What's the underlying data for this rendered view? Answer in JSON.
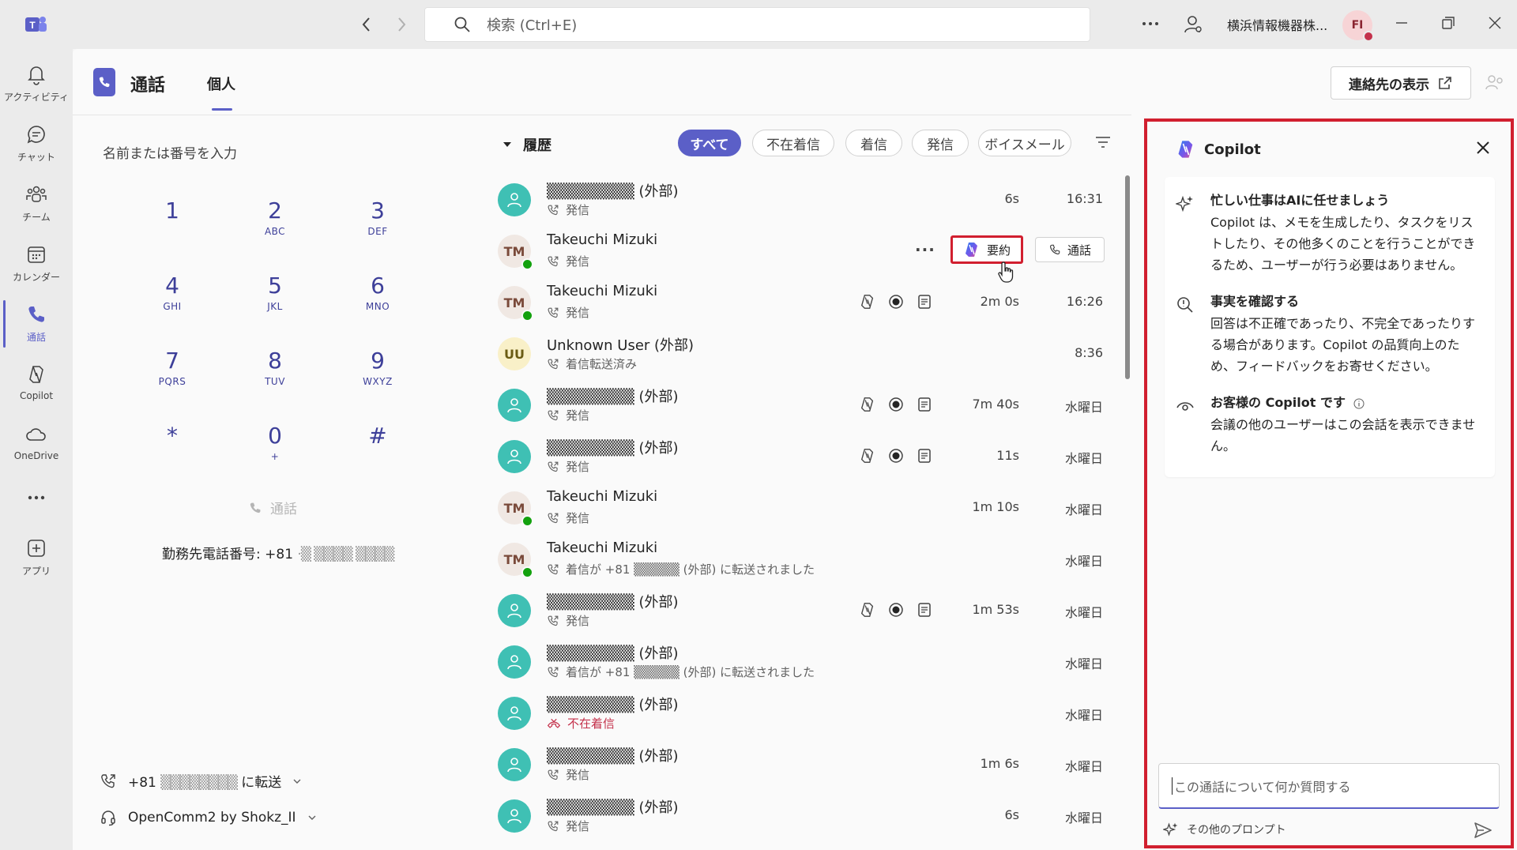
{
  "titlebar": {
    "search_placeholder": "検索 (Ctrl+E)",
    "org_name": "横浜情報機器株...",
    "avatar_initials": "FI"
  },
  "rail": {
    "items": [
      {
        "label": "アクティビティ",
        "icon": "bell-icon"
      },
      {
        "label": "チャット",
        "icon": "chat-icon"
      },
      {
        "label": "チーム",
        "icon": "teams-icon"
      },
      {
        "label": "カレンダー",
        "icon": "calendar-icon"
      },
      {
        "label": "通話",
        "icon": "phone-icon"
      },
      {
        "label": "Copilot",
        "icon": "copilot-icon"
      },
      {
        "label": "OneDrive",
        "icon": "cloud-icon"
      },
      {
        "label": "...",
        "icon": "more-icon"
      },
      {
        "label": "アプリ",
        "icon": "apps-icon"
      }
    ]
  },
  "header": {
    "title": "通話",
    "tab_personal": "個人",
    "contacts_button": "連絡先の表示"
  },
  "dialpad": {
    "input_placeholder": "名前または番号を入力",
    "keys": [
      {
        "n": "1",
        "s": ""
      },
      {
        "n": "2",
        "s": "ABC"
      },
      {
        "n": "3",
        "s": "DEF"
      },
      {
        "n": "4",
        "s": "GHI"
      },
      {
        "n": "5",
        "s": "JKL"
      },
      {
        "n": "6",
        "s": "MNO"
      },
      {
        "n": "7",
        "s": "PQRS"
      },
      {
        "n": "8",
        "s": "TUV"
      },
      {
        "n": "9",
        "s": "WXYZ"
      },
      {
        "n": "*",
        "s": ""
      },
      {
        "n": "0",
        "s": "+"
      },
      {
        "n": "#",
        "s": ""
      }
    ],
    "call_label": "通話",
    "work_phone_label": "勤務先電話番号: +81",
    "work_phone_number": "·▒ ▒▒▒▒ ▒▒▒▒",
    "forward_prefix": "+81",
    "forward_number": "▒▒▒▒▒▒▒▒",
    "forward_suffix": "に転送",
    "device": "OpenComm2 by Shokz_II"
  },
  "history": {
    "title": "履歴",
    "filters": [
      "すべて",
      "不在着信",
      "着信",
      "発信",
      "ボイスメール"
    ],
    "summary_button": "要約",
    "call_button": "通話",
    "rows": [
      {
        "name": "▒▒▒▒▒▒▒▒ (外部)",
        "sub": "発信",
        "dur": "6s",
        "time": "16:31",
        "av": "teal",
        "initials": ""
      },
      {
        "name": "Takeuchi Mizuki",
        "sub": "発信",
        "dur": "",
        "time": "",
        "av": "tm",
        "initials": "TM"
      },
      {
        "name": "Takeuchi Mizuki",
        "sub": "発信",
        "dur": "2m 0s",
        "time": "16:26",
        "av": "tm",
        "initials": "TM"
      },
      {
        "name": "Unknown User (外部)",
        "sub": "着信転送済み",
        "dur": "",
        "time": "8:36",
        "av": "uu",
        "initials": "UU"
      },
      {
        "name": "▒▒▒▒▒▒▒▒ (外部)",
        "sub": "発信",
        "dur": "7m 40s",
        "time": "水曜日",
        "av": "teal",
        "initials": ""
      },
      {
        "name": "▒▒▒▒▒▒▒▒ (外部)",
        "sub": "発信",
        "dur": "11s",
        "time": "水曜日",
        "av": "teal",
        "initials": ""
      },
      {
        "name": "Takeuchi Mizuki",
        "sub": "発信",
        "dur": "1m 10s",
        "time": "水曜日",
        "av": "tm",
        "initials": "TM"
      },
      {
        "name": "Takeuchi Mizuki",
        "sub": "着信が +81 ▒▒▒▒▒ (外部) に転送されました",
        "dur": "",
        "time": "水曜日",
        "av": "tm",
        "initials": "TM"
      },
      {
        "name": "▒▒▒▒▒▒▒▒ (外部)",
        "sub": "発信",
        "dur": "1m 53s",
        "time": "水曜日",
        "av": "teal",
        "initials": ""
      },
      {
        "name": "▒▒▒▒▒▒▒▒ (外部)",
        "sub": "着信が +81 ▒▒▒▒▒ (外部) に転送されました",
        "dur": "",
        "time": "水曜日",
        "av": "teal",
        "initials": ""
      },
      {
        "name": "▒▒▒▒▒▒▒▒ (外部)",
        "sub": "不在着信",
        "dur": "",
        "time": "水曜日",
        "av": "teal",
        "initials": ""
      },
      {
        "name": "▒▒▒▒▒▒▒▒ (外部)",
        "sub": "発信",
        "dur": "1m 6s",
        "time": "水曜日",
        "av": "teal",
        "initials": ""
      },
      {
        "name": "▒▒▒▒▒▒▒▒ (外部)",
        "sub": "発信",
        "dur": "6s",
        "time": "水曜日",
        "av": "teal",
        "initials": ""
      }
    ]
  },
  "copilot": {
    "title": "Copilot",
    "items": [
      {
        "title": "忙しい仕事はAIに任せましょう",
        "desc": "Copilot は、メモを生成したり、タスクをリストしたり、その他多くのことを行うことができるため、ユーザーが行う必要はありません。"
      },
      {
        "title": "事実を確認する",
        "desc": "回答は不正確であったり、不完全であったりする場合があります。Copilot の品質向上のため、フィードバックをお寄せください。"
      },
      {
        "title": "お客様の Copilot です",
        "desc": "会議の他のユーザーはこの会話を表示できません。"
      }
    ],
    "input_placeholder": "この通話について何か質問する",
    "more_prompts": "その他のプロンプト"
  },
  "colors": {
    "accent": "#5b5fc7",
    "highlight_red": "#d11f2f",
    "presence_green": "#13a10e",
    "avatar_teal": "#3fc0b4"
  }
}
